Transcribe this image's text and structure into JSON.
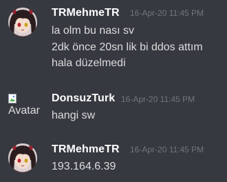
{
  "messages": [
    {
      "author": "TRMehmeTR",
      "timestamp": "16-Apr-20 11:45 PM",
      "avatar": "anime-girl-avatar",
      "lines": [
        "la olm bu nası sv",
        "2dk önce 20sn lik bi ddos attım",
        "hala düzelmedi"
      ]
    },
    {
      "author": "DonsuzTurk",
      "timestamp": "16-Apr-20 11:45 PM",
      "avatar_alt": "Avatar",
      "lines": [
        "hangi sw"
      ]
    },
    {
      "author": "TRMehmeTR",
      "timestamp": "16-Apr-20 11:45 PM",
      "avatar": "anime-girl-avatar",
      "lines": [
        "193.164.6.39"
      ]
    }
  ],
  "colors": {
    "background": "#36393f",
    "username": "#ffffff",
    "text": "#dcddde",
    "timestamp": "#72767d"
  }
}
